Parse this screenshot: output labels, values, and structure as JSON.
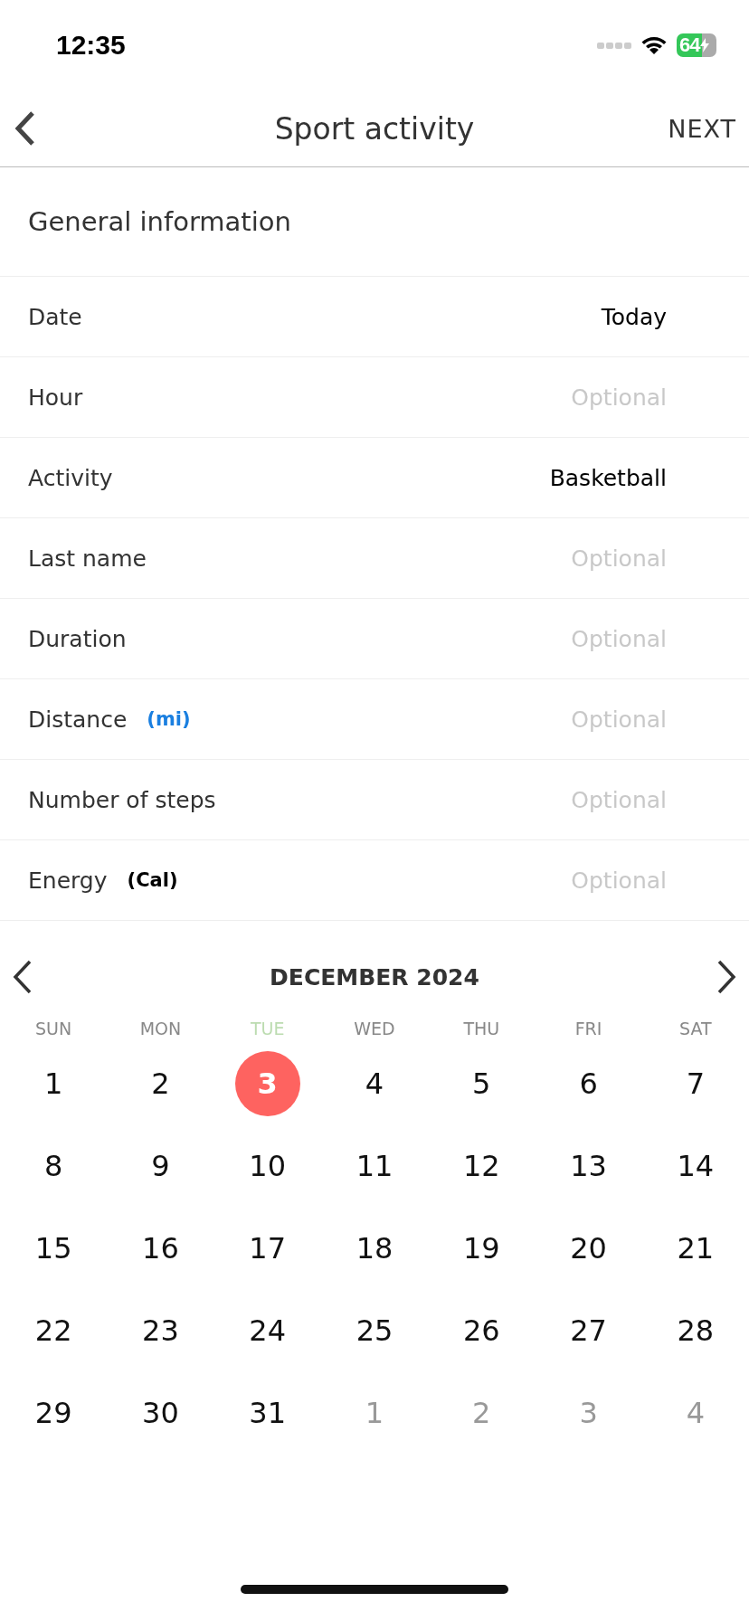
{
  "status_bar": {
    "time": "12:35",
    "battery": "64"
  },
  "header": {
    "title": "Sport activity",
    "action": "NEXT"
  },
  "section": {
    "title": "General information"
  },
  "rows": [
    {
      "label": "Date",
      "value": "Today"
    },
    {
      "label": "Hour",
      "placeholder": "Optional"
    },
    {
      "label": "Activity",
      "value": "Basketball"
    },
    {
      "label": "Last name",
      "placeholder": "Optional"
    },
    {
      "label": "Duration",
      "placeholder": "Optional"
    },
    {
      "label": "Distance",
      "unit": {
        "text": "(mi)",
        "color": "#1a7fe0"
      },
      "placeholder": "Optional"
    },
    {
      "label": "Number of steps",
      "placeholder": "Optional"
    },
    {
      "label": "Energy",
      "unit": {
        "text": "(Cal)",
        "color": "#000000"
      },
      "placeholder": "Optional"
    }
  ],
  "calendar": {
    "month": "DECEMBER 2024",
    "weekdays": [
      {
        "label": "SUN",
        "selected": false
      },
      {
        "label": "MON",
        "selected": false
      },
      {
        "label": "TUE",
        "selected": true
      },
      {
        "label": "WED",
        "selected": false
      },
      {
        "label": "THU",
        "selected": false
      },
      {
        "label": "FRI",
        "selected": false
      },
      {
        "label": "SAT",
        "selected": false
      }
    ],
    "days": [
      {
        "label": "1",
        "selected": false,
        "outside": false
      },
      {
        "label": "2",
        "selected": false,
        "outside": false
      },
      {
        "label": "3",
        "selected": true,
        "outside": false
      },
      {
        "label": "4",
        "selected": false,
        "outside": false
      },
      {
        "label": "5",
        "selected": false,
        "outside": false
      },
      {
        "label": "6",
        "selected": false,
        "outside": false
      },
      {
        "label": "7",
        "selected": false,
        "outside": false
      },
      {
        "label": "8",
        "selected": false,
        "outside": false
      },
      {
        "label": "9",
        "selected": false,
        "outside": false
      },
      {
        "label": "10",
        "selected": false,
        "outside": false
      },
      {
        "label": "11",
        "selected": false,
        "outside": false
      },
      {
        "label": "12",
        "selected": false,
        "outside": false
      },
      {
        "label": "13",
        "selected": false,
        "outside": false
      },
      {
        "label": "14",
        "selected": false,
        "outside": false
      },
      {
        "label": "15",
        "selected": false,
        "outside": false
      },
      {
        "label": "16",
        "selected": false,
        "outside": false
      },
      {
        "label": "17",
        "selected": false,
        "outside": false
      },
      {
        "label": "18",
        "selected": false,
        "outside": false
      },
      {
        "label": "19",
        "selected": false,
        "outside": false
      },
      {
        "label": "20",
        "selected": false,
        "outside": false
      },
      {
        "label": "21",
        "selected": false,
        "outside": false
      },
      {
        "label": "22",
        "selected": false,
        "outside": false
      },
      {
        "label": "23",
        "selected": false,
        "outside": false
      },
      {
        "label": "24",
        "selected": false,
        "outside": false
      },
      {
        "label": "25",
        "selected": false,
        "outside": false
      },
      {
        "label": "26",
        "selected": false,
        "outside": false
      },
      {
        "label": "27",
        "selected": false,
        "outside": false
      },
      {
        "label": "28",
        "selected": false,
        "outside": false
      },
      {
        "label": "29",
        "selected": false,
        "outside": false
      },
      {
        "label": "30",
        "selected": false,
        "outside": false
      },
      {
        "label": "31",
        "selected": false,
        "outside": false
      },
      {
        "label": "1",
        "selected": false,
        "outside": true
      },
      {
        "label": "2",
        "selected": false,
        "outside": true
      },
      {
        "label": "3",
        "selected": false,
        "outside": true
      },
      {
        "label": "4",
        "selected": false,
        "outside": true
      }
    ]
  }
}
